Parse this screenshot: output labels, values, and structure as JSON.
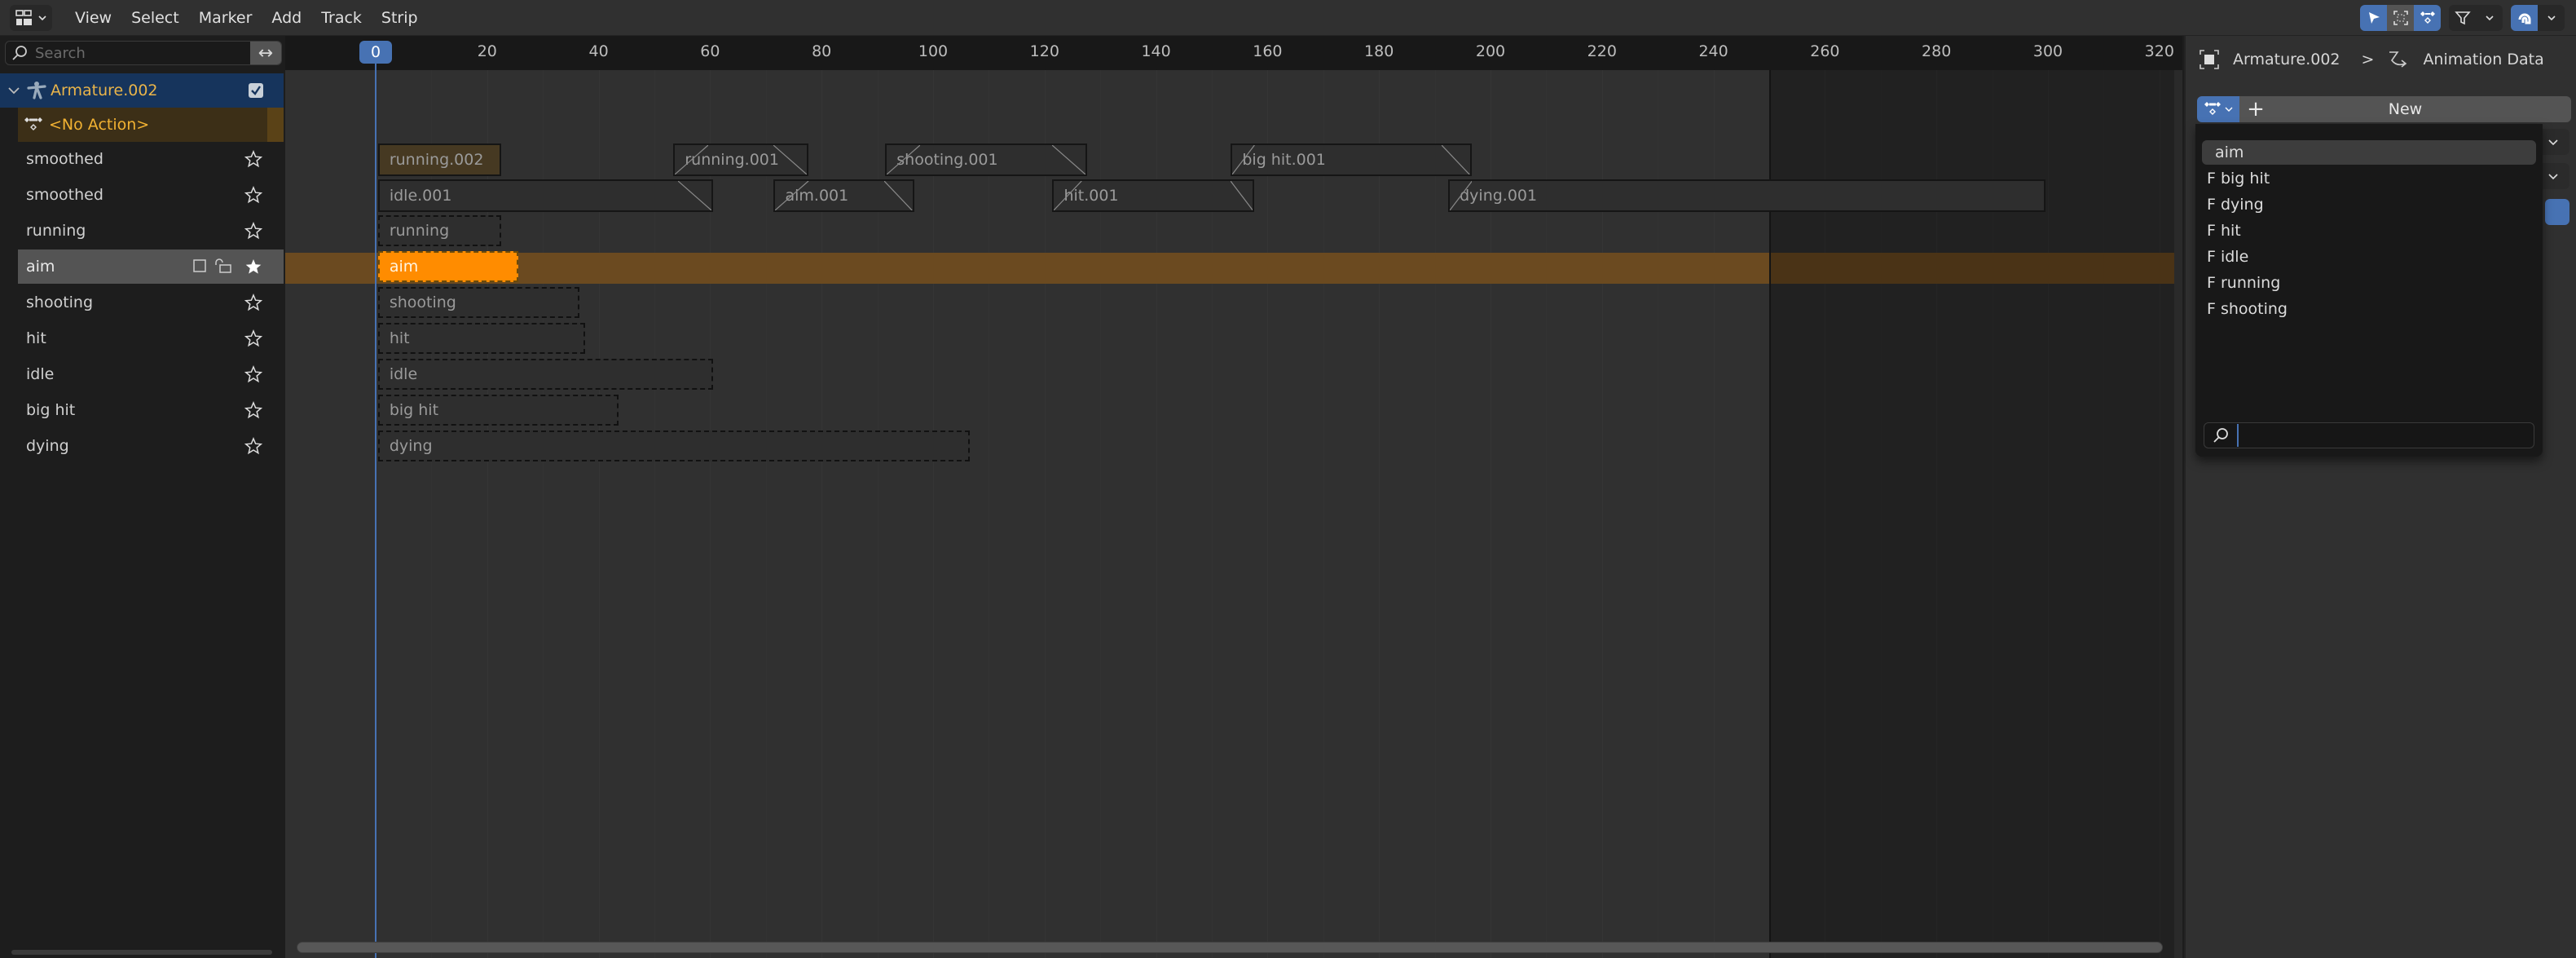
{
  "header": {
    "editor_type_icon": "nla-editor-icon",
    "menu": [
      "View",
      "Select",
      "Marker",
      "Add",
      "Track",
      "Strip"
    ],
    "tools": {
      "select_icon": "cursor-arrow-icon",
      "box_select_icon": "box-select-icon",
      "action_icon": "action-keyframes-icon",
      "filter_icon": "filter-funnel-icon",
      "snap_icon": "snap-magnet-icon"
    }
  },
  "channels": {
    "search_placeholder": "Search",
    "swap_icon": "↔",
    "object": {
      "name": "Armature.002",
      "checked": true
    },
    "action": {
      "label": "<No Action>"
    },
    "tracks": [
      {
        "name": "smoothed",
        "selected": false,
        "solo": false
      },
      {
        "name": "smoothed",
        "selected": false,
        "solo": false
      },
      {
        "name": "running",
        "selected": false,
        "solo": false
      },
      {
        "name": "aim",
        "selected": true,
        "solo": true
      },
      {
        "name": "shooting",
        "selected": false,
        "solo": false
      },
      {
        "name": "hit",
        "selected": false,
        "solo": false
      },
      {
        "name": "idle",
        "selected": false,
        "solo": false
      },
      {
        "name": "big hit",
        "selected": false,
        "solo": false
      },
      {
        "name": "dying",
        "selected": false,
        "solo": false
      }
    ]
  },
  "timeline": {
    "current_frame": "0",
    "frame_end": 250,
    "ruler_ticks": [
      20,
      40,
      60,
      80,
      100,
      120,
      140,
      160,
      180,
      200,
      220,
      240,
      260,
      280,
      300,
      320
    ],
    "strips": [
      {
        "track": 0,
        "label": "running.002",
        "start": 1,
        "end": 22,
        "style": "tweak",
        "blend_in": 0,
        "blend_out": 0
      },
      {
        "track": 0,
        "label": "running.001",
        "start": 54,
        "end": 77,
        "style": "normal",
        "blend_in": 6,
        "blend_out": 6
      },
      {
        "track": 0,
        "label": "shooting.001",
        "start": 92,
        "end": 127,
        "style": "normal",
        "blend_in": 6,
        "blend_out": 6
      },
      {
        "track": 0,
        "label": "big hit.001",
        "start": 154,
        "end": 196,
        "style": "normal",
        "blend_in": 4,
        "blend_out": 5
      },
      {
        "track": 1,
        "label": "idle.001",
        "start": 1,
        "end": 60,
        "style": "normal",
        "blend_in": 0,
        "blend_out": 6
      },
      {
        "track": 1,
        "label": "aim.001",
        "start": 72,
        "end": 96,
        "style": "normal",
        "blend_in": 6,
        "blend_out": 5
      },
      {
        "track": 1,
        "label": "hit.001",
        "start": 122,
        "end": 157,
        "style": "normal",
        "blend_in": 5,
        "blend_out": 4
      },
      {
        "track": 1,
        "label": "dying.001",
        "start": 193,
        "end": 299,
        "style": "normal",
        "blend_in": 4,
        "blend_out": 0
      },
      {
        "track": 2,
        "label": "running",
        "start": 1,
        "end": 22,
        "style": "dashed"
      },
      {
        "track": 3,
        "label": "aim",
        "start": 1,
        "end": 25,
        "style": "active"
      },
      {
        "track": 4,
        "label": "shooting",
        "start": 1,
        "end": 36,
        "style": "dashed"
      },
      {
        "track": 5,
        "label": "hit",
        "start": 1,
        "end": 37,
        "style": "dashed"
      },
      {
        "track": 6,
        "label": "idle",
        "start": 1,
        "end": 60,
        "style": "dashed"
      },
      {
        "track": 7,
        "label": "big hit",
        "start": 1,
        "end": 43,
        "style": "dashed"
      },
      {
        "track": 8,
        "label": "dying",
        "start": 1,
        "end": 106,
        "style": "dashed"
      }
    ],
    "highlighted_track": 3
  },
  "sidebar": {
    "breadcrumb": {
      "object": "Armature.002",
      "separator": ">",
      "section": "Animation Data"
    },
    "new_button": "New",
    "popup": {
      "items": [
        "aim",
        "F big hit",
        "F dying",
        "F hit",
        "F idle",
        "F running",
        "F shooting"
      ],
      "highlighted": 0,
      "search_value": ""
    }
  },
  "colors": {
    "accent_blue": "#4772b3",
    "active_strip": "#ff8c00",
    "object_name": "#e9b44a"
  }
}
